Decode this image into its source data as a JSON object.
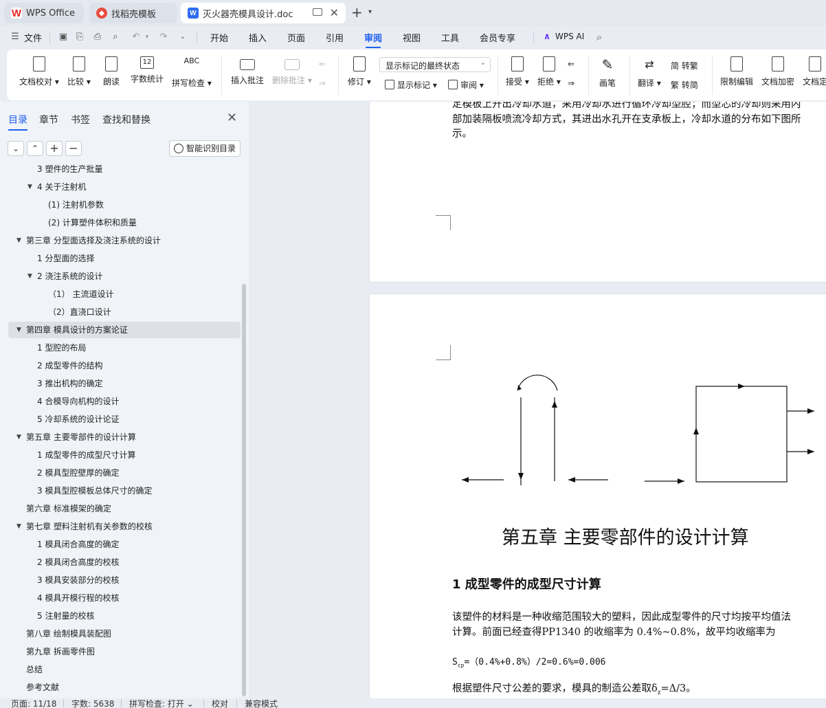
{
  "tabs": [
    {
      "label": "WPS Office"
    },
    {
      "label": "找稻壳模板"
    },
    {
      "label": "灭火器壳模具设计.doc"
    }
  ],
  "menu": {
    "file": "文件",
    "items": [
      "开始",
      "插入",
      "页面",
      "引用",
      "审阅",
      "视图",
      "工具",
      "会员专享"
    ],
    "active": "审阅",
    "wps_ai": "WPS AI"
  },
  "ribbon": {
    "doc_check": "文档校对",
    "compare": "比较",
    "read_aloud": "朗读",
    "word_count": "字数统计",
    "spell_check": "拼写检查",
    "insert_comment": "插入批注",
    "delete_comment": "删除批注",
    "track": "修订",
    "markup_select": "显示标记的最终状态",
    "show_markup": "显示标记",
    "review": "审阅",
    "accept": "接受",
    "reject": "拒绝",
    "ink": "画笔",
    "translate": "翻译",
    "to_traditional": "转繁",
    "to_simplified": "转简",
    "restrict_edit": "限制编辑",
    "encrypt": "文档加密",
    "finalize": "文档定"
  },
  "nav": {
    "tabs": [
      "目录",
      "章节",
      "书签",
      "查找和替换"
    ],
    "smart_toc": "智能识别目录",
    "toc": [
      {
        "text": "3   塑件的生产批量",
        "indent": 42,
        "arrow": ""
      },
      {
        "text": "4   关于注射机",
        "indent": 42,
        "arrow": "▼"
      },
      {
        "text": "(1)   注射机参数",
        "indent": 58,
        "arrow": ""
      },
      {
        "text": "(2)   计算塑件体积和质量",
        "indent": 58,
        "arrow": ""
      },
      {
        "text": "第三章   分型面选择及浇注系统的设计",
        "indent": 26,
        "arrow": "▼"
      },
      {
        "text": "1   分型面的选择",
        "indent": 42,
        "arrow": ""
      },
      {
        "text": "2   浇注系统的设计",
        "indent": 42,
        "arrow": "▼"
      },
      {
        "text": "（1）   主流道设计",
        "indent": 58,
        "arrow": ""
      },
      {
        "text": "（2）直浇口设计",
        "indent": 58,
        "arrow": ""
      },
      {
        "text": "第四章   模具设计的方案论证",
        "indent": 26,
        "arrow": "▼",
        "selected": true
      },
      {
        "text": "1   型腔的布局",
        "indent": 42,
        "arrow": ""
      },
      {
        "text": "2   成型零件的结构",
        "indent": 42,
        "arrow": ""
      },
      {
        "text": "3   推出机构的确定",
        "indent": 42,
        "arrow": ""
      },
      {
        "text": "4   合模导向机构的设计",
        "indent": 42,
        "arrow": ""
      },
      {
        "text": "5   冷却系统的设计论证",
        "indent": 42,
        "arrow": ""
      },
      {
        "text": "第五章   主要零部件的设计计算",
        "indent": 26,
        "arrow": "▼"
      },
      {
        "text": "1   成型零件的成型尺寸计算",
        "indent": 42,
        "arrow": ""
      },
      {
        "text": "2   模具型腔壁厚的确定",
        "indent": 42,
        "arrow": ""
      },
      {
        "text": "3   模具型腔模板总体尺寸的确定",
        "indent": 42,
        "arrow": ""
      },
      {
        "text": "第六章   标准模架的确定",
        "indent": 26,
        "arrow": ""
      },
      {
        "text": "第七章   塑料注射机有关参数的校核",
        "indent": 26,
        "arrow": "▼"
      },
      {
        "text": "1   模具闭合高度的确定",
        "indent": 42,
        "arrow": ""
      },
      {
        "text": "2   模具闭合高度的校核",
        "indent": 42,
        "arrow": ""
      },
      {
        "text": "3   模具安装部分的校核",
        "indent": 42,
        "arrow": ""
      },
      {
        "text": "4   模具开模行程的校核",
        "indent": 42,
        "arrow": ""
      },
      {
        "text": "5   注射量的校核",
        "indent": 42,
        "arrow": ""
      },
      {
        "text": "第八章   绘制模具装配图",
        "indent": 26,
        "arrow": ""
      },
      {
        "text": "第九章   拆画零件图",
        "indent": 26,
        "arrow": ""
      },
      {
        "text": "总结",
        "indent": 26,
        "arrow": ""
      },
      {
        "text": "参考文献",
        "indent": 26,
        "arrow": ""
      }
    ]
  },
  "document": {
    "page1_lines": [
      "定模板上开出冷却水道，采用冷却水进行循环冷却型腔；而型芯的冷却则采用内",
      "部加装隔板喷流冷却方式，其进出水孔开在支承板上，冷却水道的分布如下图所",
      "示。"
    ],
    "chapter_title": "第五章    主要零部件的设计计算",
    "section_title": "1    成型零件的成型尺寸计算",
    "para1_line1": "  该塑件的材料是一种收缩范围较大的塑料，因此成型零件的尺寸均按平均值法",
    "para1_line2": "计算。前面已经查得PP1340 的收缩率为 0.4%~0.8%，故平均收缩率为",
    "formula": "S",
    "formula_sub": "cp",
    "formula_rest": "=（0.4%+0.8%）/2=0.6%=0.006",
    "para2": "根据塑件尺寸公差的要求，模具的制造公差取δ",
    "para2_sub": "z",
    "para2_rest": "=Δ/3。"
  },
  "status": {
    "page": "页面: 11/18",
    "words": "字数: 5638",
    "spell": "拼写检查: 打开",
    "proof": "校对",
    "compat": "兼容模式"
  },
  "colors": {
    "accent": "#1c5ef0",
    "wps_red": "#e62b2b"
  }
}
